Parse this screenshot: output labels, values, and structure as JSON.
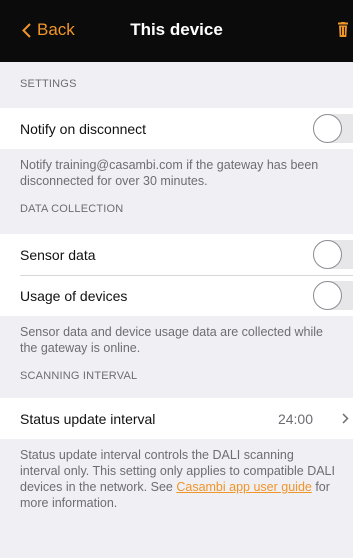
{
  "nav": {
    "back_label": "Back",
    "title": "This device"
  },
  "settings": {
    "header": "SETTINGS",
    "notify_label": "Notify on disconnect",
    "notify_on": false,
    "footer": "Notify training@casambi.com if the gateway has been disconnected for over 30 minutes."
  },
  "data_collection": {
    "header": "DATA COLLECTION",
    "sensor_label": "Sensor data",
    "sensor_on": false,
    "usage_label": "Usage of devices",
    "usage_on": false,
    "footer": "Sensor data and device usage data are collected while the gateway is online."
  },
  "scanning": {
    "header": "SCANNING INTERVAL",
    "status_label": "Status update interval",
    "status_value": "24:00",
    "footer_before": "Status update interval controls the DALI scanning interval only. This setting only applies to compatible DALI devices in the network. See ",
    "footer_link": "Casambi app user guide",
    "footer_after": " for more information."
  },
  "colors": {
    "accent": "#f0952a",
    "nav_bg": "#0b0b0b",
    "group_bg": "#efeff4"
  }
}
